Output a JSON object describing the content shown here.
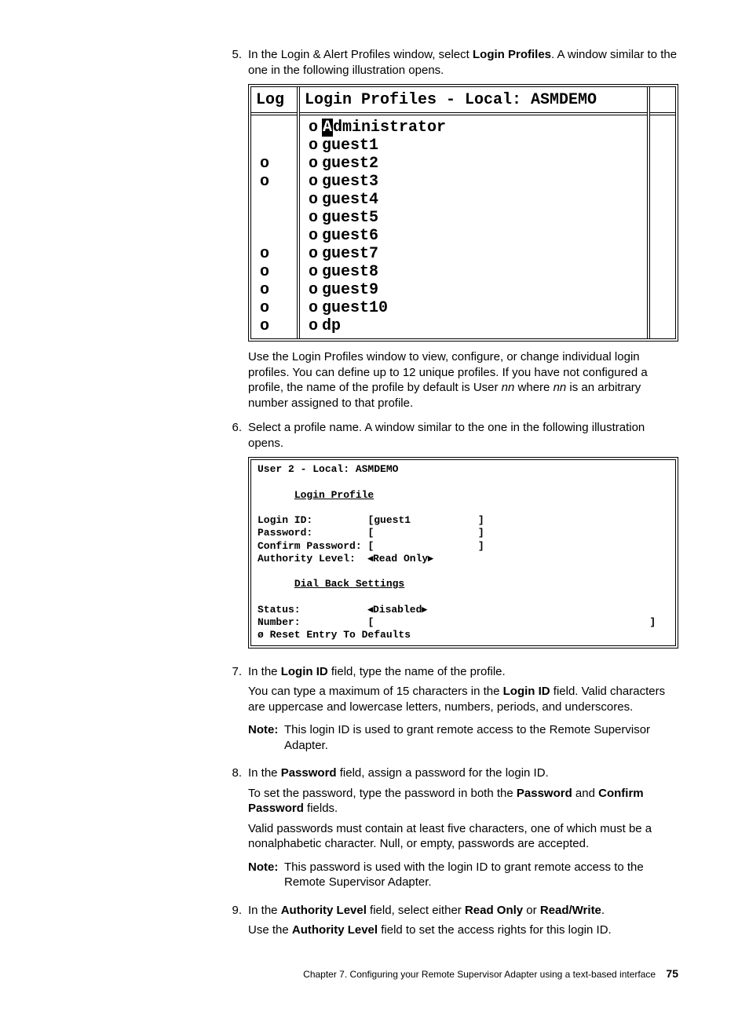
{
  "steps": {
    "s5": {
      "num": "5.",
      "text_a": "In the Login & Alert Profiles window, select ",
      "bold_a": "Login Profiles",
      "text_b": ". A window similar to the one in the following illustration opens."
    },
    "fig1": {
      "col1_title": "Log",
      "col2_title": "Login Profiles - Local: ASMDEMO",
      "entries": [
        "Administrator",
        "guest1",
        "guest2",
        "guest3",
        "guest4",
        "guest5",
        "guest6",
        "guest7",
        "guest8",
        "guest9",
        "guest10",
        "dp"
      ],
      "cursor_char": "A",
      "admin_rest": "dministrator"
    },
    "after5_a": "Use the Login Profiles window to view, configure, or change individual login profiles. You can define up to 12 unique profiles. If you have not configured a profile, the name of the profile by default is User ",
    "after5_nn1": "nn",
    "after5_b": " where ",
    "after5_nn2": "nn",
    "after5_c": " is an arbitrary number assigned to that profile.",
    "s6": {
      "num": "6.",
      "text": "Select a profile name. A window similar to the one in the following illustration opens."
    },
    "fig2": {
      "title": "User 2 - Local: ASMDEMO",
      "section1": "Login Profile",
      "login_id_label": "Login ID:",
      "login_id_val": "[guest1           ]",
      "password_label": "Password:",
      "password_val": "[                 ]",
      "confirm_label": "Confirm Password:",
      "confirm_val": "[                 ]",
      "auth_label": "Authority Level:",
      "auth_val": "◂Read Only▸",
      "section2": "Dial Back Settings",
      "status_label": "Status:",
      "status_val": "◂Disabled▸",
      "number_label": "Number:",
      "number_val_l": "[",
      "number_val_r": "]",
      "reset": "ø Reset Entry To Defaults"
    },
    "s7": {
      "num": "7.",
      "text_a": "In the ",
      "bold_a": "Login ID",
      "text_b": " field, type the name of the profile.",
      "para_a": "You can type a maximum of 15 characters in the ",
      "para_bold": "Login ID",
      "para_b": " field. Valid characters are uppercase and lowercase letters, numbers, periods, and underscores.",
      "note_label": "Note:",
      "note_text": "This login ID is used to grant remote access to the Remote Supervisor Adapter."
    },
    "s8": {
      "num": "8.",
      "text_a": "In the ",
      "bold_a": "Password",
      "text_b": " field, assign a password for the login ID.",
      "para1_a": "To set the password, type the password in both the ",
      "para1_b1": "Password",
      "para1_b": " and ",
      "para1_b2": "Confirm Password",
      "para1_c": " fields.",
      "para2": "Valid passwords must contain at least five characters, one of which must be a nonalphabetic character. Null, or empty, passwords are accepted.",
      "note_label": "Note:",
      "note_text": "This password is used with the login ID to grant remote access to the Remote Supervisor Adapter."
    },
    "s9": {
      "num": "9.",
      "text_a": "In the ",
      "bold_a": "Authority Level",
      "text_b": " field, select either ",
      "bold_b": "Read Only",
      "text_c": " or ",
      "bold_c": "Read/Write",
      "text_d": ".",
      "para_a": "Use the ",
      "para_bold": "Authority Level",
      "para_b": " field to set the access rights for this login ID."
    }
  },
  "footer": {
    "text": "Chapter 7. Configuring your Remote Supervisor Adapter using a text-based interface",
    "page": "75"
  }
}
